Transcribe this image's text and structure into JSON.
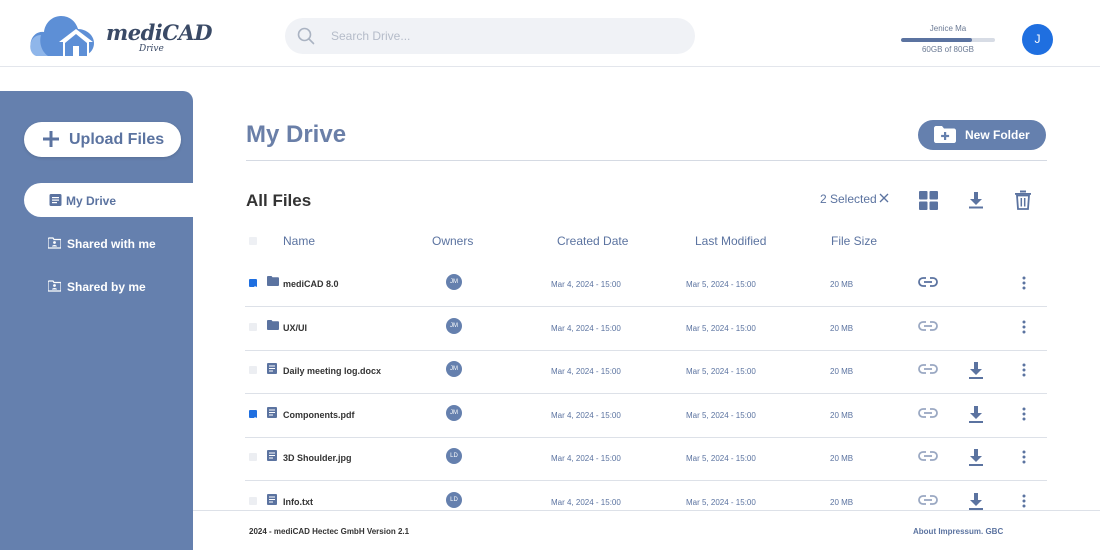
{
  "brand": {
    "name": "mediCAD",
    "product": "Drive"
  },
  "search": {
    "placeholder": "Search Drive..."
  },
  "user": {
    "name": "Jenice Ma",
    "initial": "J",
    "storage_text": "60GB of 80GB",
    "storage_used_fraction": 0.75
  },
  "sidebar": {
    "upload_label": "Upload Files",
    "items": [
      {
        "label": "My Drive",
        "icon": "document-icon",
        "active": true
      },
      {
        "label": "Shared with me",
        "icon": "shared-folder-icon",
        "active": false
      },
      {
        "label": "Shared by me",
        "icon": "shared-folder-icon",
        "active": false
      }
    ]
  },
  "main": {
    "title": "My Drive",
    "new_folder_label": "New Folder",
    "section_title": "All Files",
    "selected_label": "2 Selected",
    "columns": [
      "Name",
      "Owners",
      "Created Date",
      "Last Modified",
      "File Size"
    ],
    "rows": [
      {
        "checked": true,
        "type": "folder",
        "name": "mediCAD 8.0",
        "owner": "JM",
        "created": "Mar 4, 2024 - 15:00",
        "modified": "Mar 5, 2024 - 15:00",
        "size": "20 MB",
        "downloadable": false,
        "link_active": true
      },
      {
        "checked": false,
        "type": "folder",
        "name": "UX/UI",
        "owner": "JM",
        "created": "Mar 4, 2024 - 15:00",
        "modified": "Mar 5, 2024 - 15:00",
        "size": "20 MB",
        "downloadable": false,
        "link_active": false
      },
      {
        "checked": false,
        "type": "file",
        "name": "Daily meeting log.docx",
        "owner": "JM",
        "created": "Mar 4, 2024 - 15:00",
        "modified": "Mar 5, 2024 - 15:00",
        "size": "20 MB",
        "downloadable": true,
        "link_active": false
      },
      {
        "checked": true,
        "type": "file",
        "name": "Components.pdf",
        "owner": "JM",
        "created": "Mar 4, 2024 - 15:00",
        "modified": "Mar 5, 2024 - 15:00",
        "size": "20 MB",
        "downloadable": true,
        "link_active": false
      },
      {
        "checked": false,
        "type": "file",
        "name": "3D Shoulder.jpg",
        "owner": "LD",
        "created": "Mar 4, 2024 - 15:00",
        "modified": "Mar 5, 2024 - 15:00",
        "size": "20 MB",
        "downloadable": true,
        "link_active": false
      },
      {
        "checked": false,
        "type": "file",
        "name": "Info.txt",
        "owner": "LD",
        "created": "Mar 4, 2024 - 15:00",
        "modified": "Mar 5, 2024 - 15:00",
        "size": "20 MB",
        "downloadable": true,
        "link_active": false
      }
    ]
  },
  "footer": {
    "left": "2024 - mediCAD Hectec GmbH Version 2.1",
    "right": "About Impressum. GBC"
  },
  "colors": {
    "accent": "#6580ae",
    "primary_blue": "#1f6fe0",
    "text_blue": "#5b73a0"
  }
}
